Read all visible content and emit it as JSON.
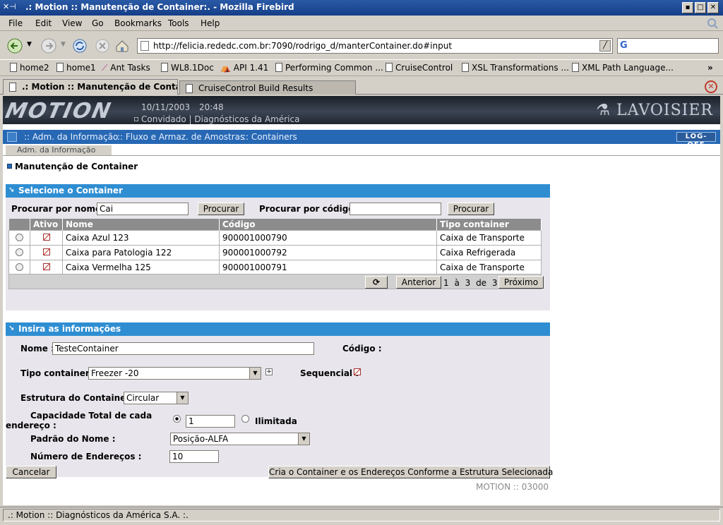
{
  "window": {
    "title": ".: Motion :: Manutenção de Container:. - Mozilla Firebird",
    "icon": "x-icon"
  },
  "menu": [
    "File",
    "Edit",
    "View",
    "Go",
    "Bookmarks",
    "Tools",
    "Help"
  ],
  "address": {
    "url": "http://felicia.rededc.com.br:7090/rodrigo_d/manterContainer.do#input",
    "search_engine": "G"
  },
  "bookmarks": [
    "home2",
    "home1",
    "Ant Tasks",
    "WL8.1Doc",
    "API 1.41",
    "Performing Common ...",
    "CruiseControl",
    "XSL Transformations ...",
    "XML Path Language...",
    "»"
  ],
  "tabs": [
    ".: Motion :: Manutenção de Contain...",
    "CruiseControl Build Results"
  ],
  "app": {
    "logo": "MOTION",
    "date": "10/11/2003",
    "time": "20:48",
    "user": "Convidado",
    "org": "Diagnósticos da América",
    "brand": "LAVOISIER",
    "nav": [
      ":: Adm. da Informação",
      ":: Fluxo e Armaz. de Amostras",
      ":: Containers"
    ],
    "logoff": "LOG-OFF",
    "subtab": "Adm. da Informação",
    "page_title": "Manutenção de Container"
  },
  "select_section": {
    "title": "Selecione o Container",
    "search_name_label": "Procurar por nome :",
    "search_name_value": "Cai",
    "search_code_label": "Procurar por código :",
    "search_code_value": "",
    "search_button": "Procurar",
    "columns": [
      "Ativo",
      "Nome",
      "Código",
      "Tipo container"
    ],
    "rows": [
      {
        "nome": "Caixa Azul 123",
        "codigo": "900001000790",
        "tipo": "Caixa de Transporte"
      },
      {
        "nome": "Caixa para Patologia 122",
        "codigo": "900001000792",
        "tipo": "Caixa Refrigerada"
      },
      {
        "nome": "Caixa Vermelha 125",
        "codigo": "900001000791",
        "tipo": "Caixa de Transporte"
      }
    ],
    "prev": "Anterior",
    "next": "Próximo",
    "page_info": "1 à 3 de 3"
  },
  "insert_section": {
    "title": "Insira as informações",
    "nome_label": "Nome :",
    "nome_value": "TesteContainer",
    "codigo_label": "Código :",
    "tipo_label": "Tipo container :",
    "tipo_value": "Freezer -20",
    "sequencial_label": "Sequencial :",
    "estrutura_label": "Estrutura do Container :",
    "estrutura_value": "Circular",
    "capacidade_label_1": "Capacidade Total de cada",
    "capacidade_label_2": "endereço :",
    "capacidade_value": "1",
    "ilimitada_label": "Ilimitada",
    "padrao_label": "Padrão do Nome :",
    "padrao_value": "Posição-ALFA",
    "num_label": "Número de Endereços :",
    "num_value": "10",
    "cancel": "Cancelar",
    "create": "Cria o Container e os Endereços Conforme a Estrutura Selecionada"
  },
  "footer": "MOTION :: 03000",
  "status": ".: Motion :: Diagnósticos da América S.A. :."
}
